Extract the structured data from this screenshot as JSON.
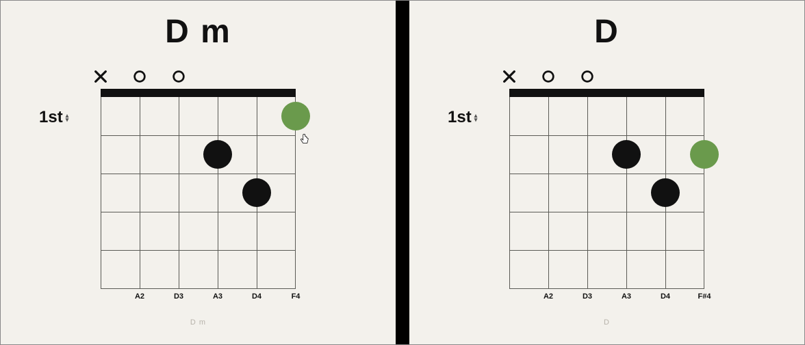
{
  "chart_data": [
    {
      "type": "chord-diagram",
      "name": "D m",
      "start_fret_label": "1st",
      "strings": 6,
      "frets_shown": 5,
      "string_status": [
        "mute",
        "open",
        "open",
        "finger",
        "finger",
        "finger"
      ],
      "fingers": [
        {
          "string": 4,
          "fret": 2,
          "color": "black"
        },
        {
          "string": 5,
          "fret": 3,
          "color": "black"
        },
        {
          "string": 6,
          "fret": 1,
          "color": "green"
        }
      ],
      "note_labels": [
        "",
        "A2",
        "D3",
        "A3",
        "D4",
        "F4"
      ],
      "caption": "D m"
    },
    {
      "type": "chord-diagram",
      "name": "D",
      "start_fret_label": "1st",
      "strings": 6,
      "frets_shown": 5,
      "string_status": [
        "mute",
        "open",
        "open",
        "finger",
        "finger",
        "finger"
      ],
      "fingers": [
        {
          "string": 4,
          "fret": 2,
          "color": "black"
        },
        {
          "string": 5,
          "fret": 3,
          "color": "black"
        },
        {
          "string": 6,
          "fret": 2,
          "color": "green"
        }
      ],
      "note_labels": [
        "",
        "A2",
        "D3",
        "A3",
        "D4",
        "F#4"
      ],
      "caption": "D"
    }
  ],
  "ui": {
    "cursor_visible_panel": 0
  }
}
